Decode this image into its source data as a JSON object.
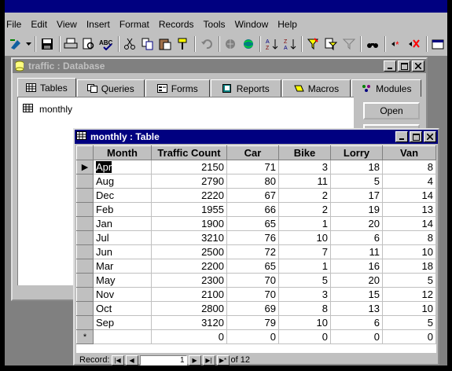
{
  "menubar": [
    "File",
    "Edit",
    "View",
    "Insert",
    "Format",
    "Records",
    "Tools",
    "Window",
    "Help"
  ],
  "toolbar": {
    "icons": [
      "design-view-icon",
      "save-icon",
      "print-icon",
      "print-preview-icon",
      "spelling-icon",
      "cut-icon",
      "copy-icon",
      "paste-icon",
      "format-painter-icon",
      "undo-icon",
      "insert-hyperlink-icon",
      "web-toolbar-icon",
      "sort-ascending-icon",
      "sort-descending-icon",
      "filter-by-selection-icon",
      "filter-by-form-icon",
      "apply-filter-icon",
      "find-icon",
      "new-record-icon",
      "delete-record-icon",
      "properties-icon"
    ]
  },
  "database_window": {
    "title": "traffic : Database",
    "tabs": [
      {
        "label": "Tables",
        "icon": "table-icon"
      },
      {
        "label": "Queries",
        "icon": "query-icon"
      },
      {
        "label": "Forms",
        "icon": "form-icon"
      },
      {
        "label": "Reports",
        "icon": "report-icon"
      },
      {
        "label": "Macros",
        "icon": "macro-icon"
      },
      {
        "label": "Modules",
        "icon": "module-icon"
      }
    ],
    "objects": [
      "monthly"
    ],
    "open_button": "Open"
  },
  "table_window": {
    "title": "monthly : Table",
    "columns": [
      "Month",
      "Traffic Count",
      "Car",
      "Bike",
      "Lorry",
      "Van"
    ],
    "rows": [
      [
        "Apr",
        2150,
        71,
        3,
        18,
        8
      ],
      [
        "Aug",
        2790,
        80,
        11,
        5,
        4
      ],
      [
        "Dec",
        2220,
        67,
        2,
        17,
        14
      ],
      [
        "Feb",
        1955,
        66,
        2,
        19,
        13
      ],
      [
        "Jan",
        1900,
        65,
        1,
        20,
        14
      ],
      [
        "Jul",
        3210,
        76,
        10,
        6,
        8
      ],
      [
        "Jun",
        2500,
        72,
        7,
        11,
        10
      ],
      [
        "Mar",
        2200,
        65,
        1,
        16,
        18
      ],
      [
        "May",
        2300,
        70,
        5,
        20,
        5
      ],
      [
        "Nov",
        2100,
        70,
        3,
        15,
        12
      ],
      [
        "Oct",
        2800,
        69,
        8,
        13,
        10
      ],
      [
        "Sep",
        3120,
        79,
        10,
        6,
        5
      ]
    ],
    "new_row": [
      "",
      0,
      0,
      0,
      0,
      0
    ],
    "current_row_marker": "▶",
    "new_row_marker": "*",
    "navigator": {
      "label": "Record:",
      "current": "1",
      "of_text": "of 12"
    }
  }
}
